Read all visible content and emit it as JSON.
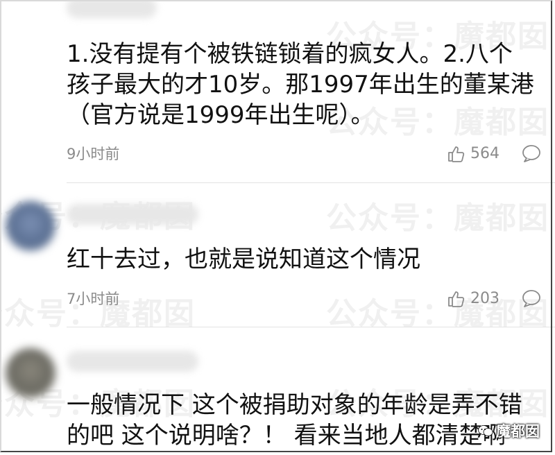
{
  "watermark": "公众号：魔都囡",
  "comments": [
    {
      "text": "1.没有提有个被铁链锁着的疯女人。2.八个孩子最大的才10岁。那1997年出生的董某港（官方说是1999年出生呢）。",
      "time": "9小时前",
      "likes": "564"
    },
    {
      "text": "红十去过，也就是说知道这个情况",
      "time": "7小时前",
      "likes": "203"
    },
    {
      "text": "一般情况下 这个被捐助对象的年龄是弄不错的吧 这个说明啥？！ 看来当地人都清楚啊"
    }
  ],
  "badge": {
    "label": "魔都囡",
    "icon": "wechat-icon"
  },
  "colors": {
    "text": "#111111",
    "meta": "#8a8a8a",
    "divider": "#e2e2e2",
    "avatar2": "#5a6f92",
    "avatar3": "#6b6a62"
  }
}
